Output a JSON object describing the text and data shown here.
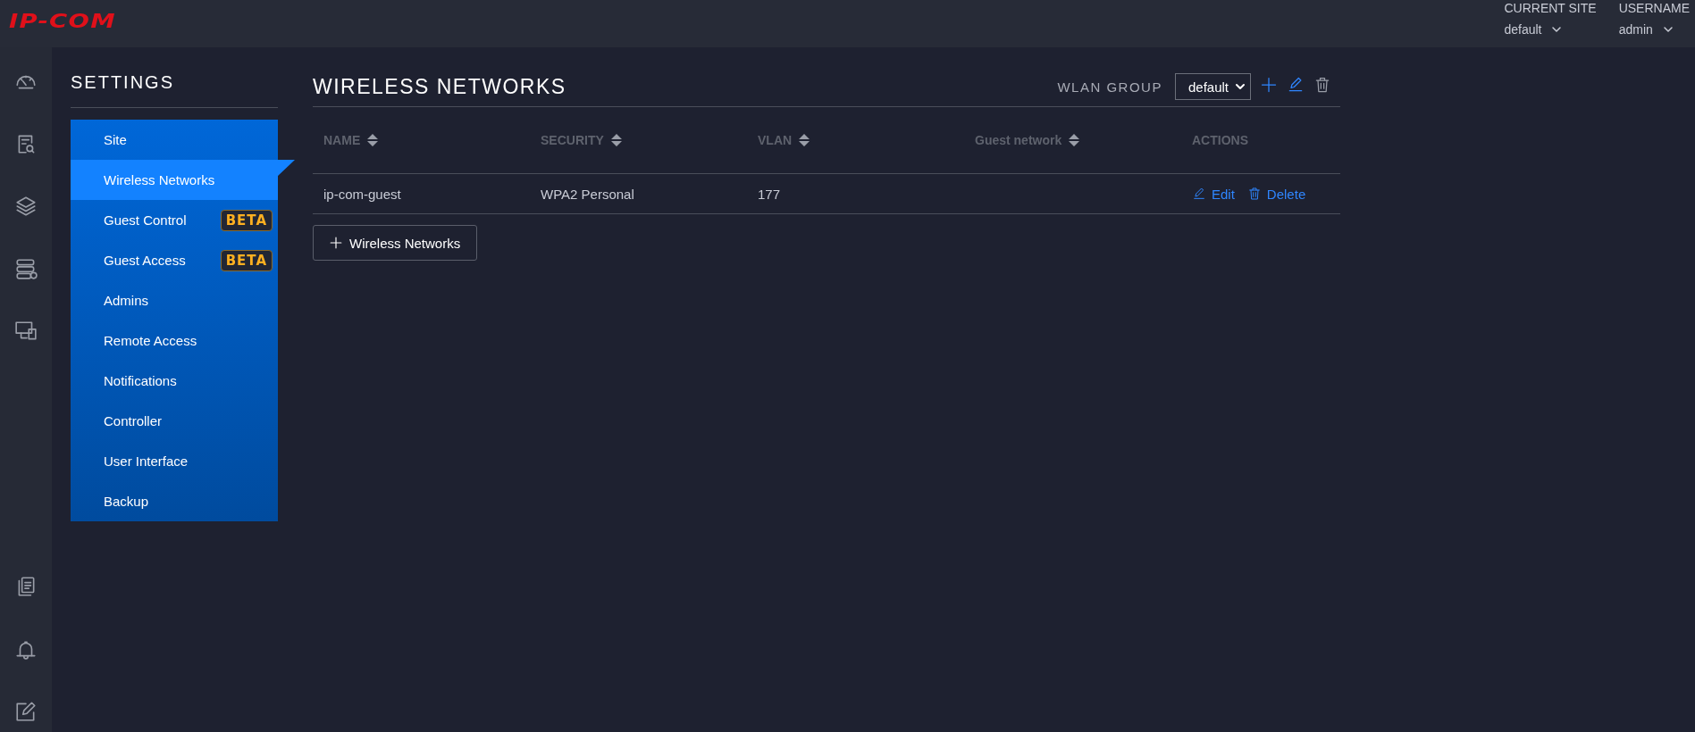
{
  "top_bar": {
    "logo": "IP-COM",
    "current_site": {
      "label": "CURRENT SITE",
      "value": "default"
    },
    "username": {
      "label": "USERNAME",
      "value": "admin"
    }
  },
  "settings": {
    "title": "SETTINGS",
    "items": [
      {
        "label": "Site",
        "selected": false
      },
      {
        "label": "Wireless Networks",
        "selected": true
      },
      {
        "label": "Guest Control",
        "selected": false,
        "badge": "BETA"
      },
      {
        "label": "Guest Access",
        "selected": false,
        "badge": "BETA"
      },
      {
        "label": "Admins",
        "selected": false
      },
      {
        "label": "Remote Access",
        "selected": false
      },
      {
        "label": "Notifications",
        "selected": false
      },
      {
        "label": "Controller",
        "selected": false
      },
      {
        "label": "User Interface",
        "selected": false
      },
      {
        "label": "Backup",
        "selected": false
      }
    ]
  },
  "page": {
    "title": "WIRELESS NETWORKS",
    "wlan_group": {
      "label": "WLAN GROUP",
      "value": "default"
    },
    "table": {
      "columns": [
        {
          "label": "NAME",
          "sortable": true
        },
        {
          "label": "SECURITY",
          "sortable": true
        },
        {
          "label": "VLAN",
          "sortable": true
        },
        {
          "label": "Guest network",
          "sortable": true
        },
        {
          "label": "ACTIONS",
          "sortable": false
        }
      ],
      "rows": [
        {
          "name": "ip-com-guest",
          "security": "WPA2 Personal",
          "vlan": "177",
          "actions": [
            "Edit",
            "Delete"
          ]
        }
      ]
    },
    "add_button": "Wireless Networks"
  }
}
